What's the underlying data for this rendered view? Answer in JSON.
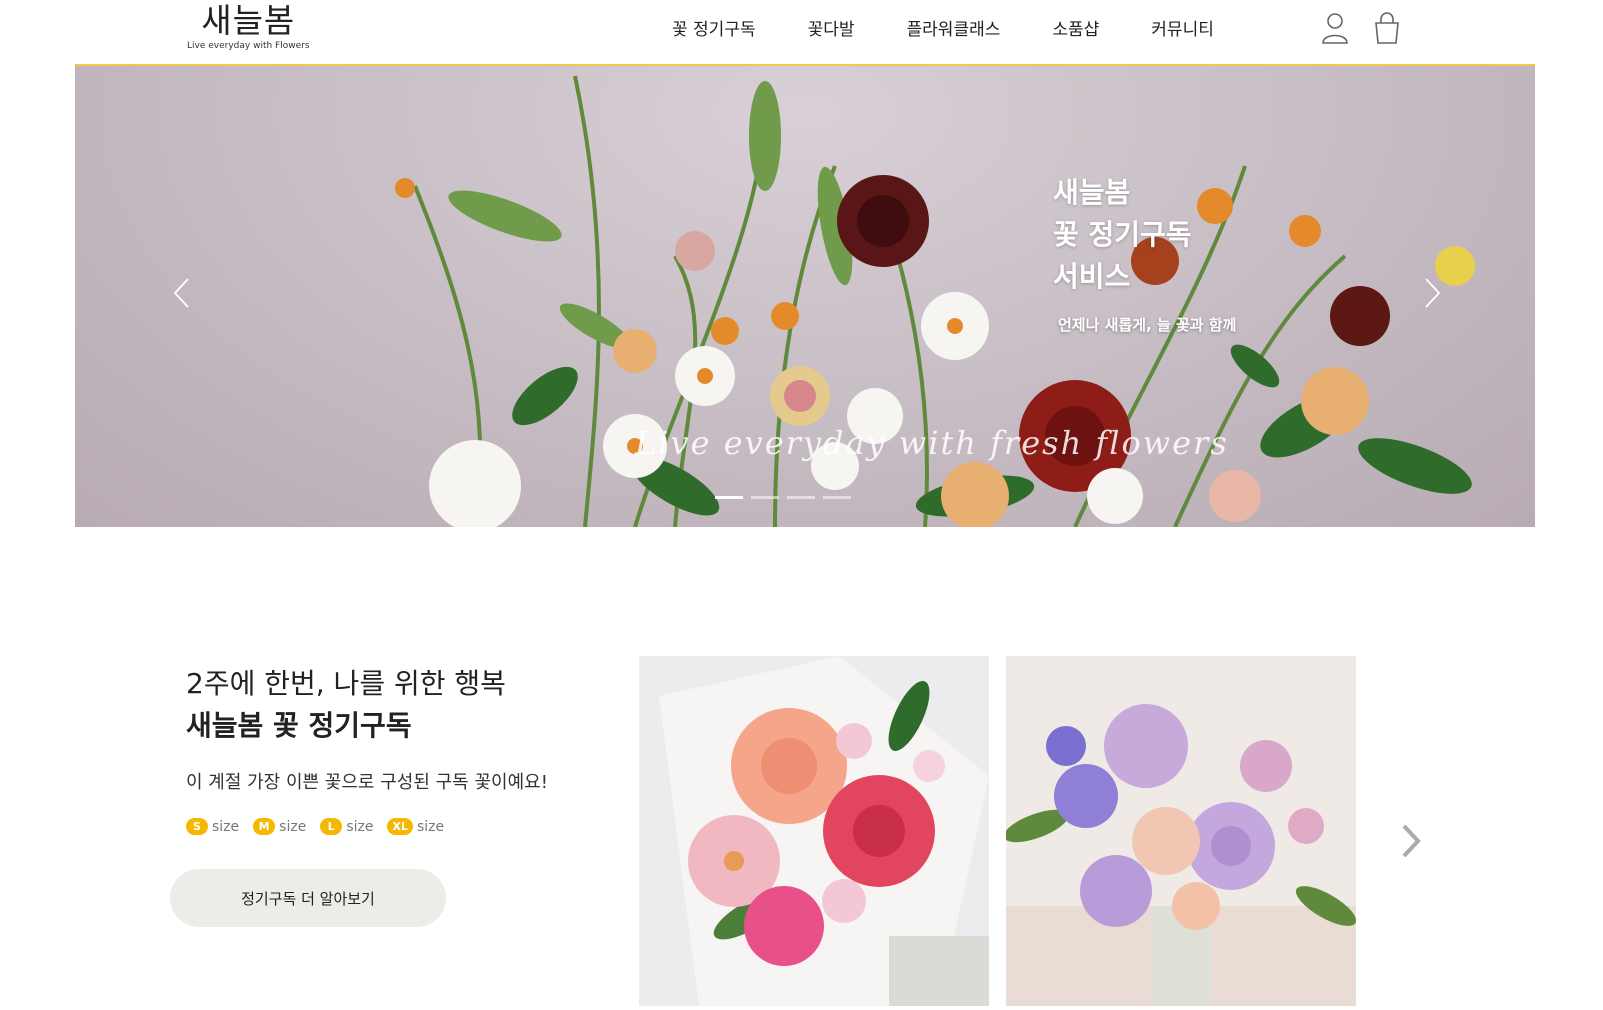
{
  "brand": {
    "name": "새늘봄",
    "tagline": "Live everyday with Flowers"
  },
  "nav": {
    "items": [
      {
        "label": "꽃 정기구독"
      },
      {
        "label": "꽃다발"
      },
      {
        "label": "플라워클래스"
      },
      {
        "label": "소품샵"
      },
      {
        "label": "커뮤니티"
      }
    ]
  },
  "header_icons": [
    "user-icon",
    "shopping-bag-icon"
  ],
  "hero": {
    "title_lines": [
      "새늘봄",
      "꽃 정기구독",
      "서비스"
    ],
    "subtitle": "언제나 새롭게, 늘 꽃과 함께",
    "script_text": "Live everyday with fresh flowers",
    "slide_count": 4,
    "active_slide": 1
  },
  "subscription": {
    "heading_line1": "2주에 한번, 나를 위한 행복",
    "heading_line2": "새늘봄 꽃 정기구독",
    "description": "이 계절 가장 이쁜 꽃으로 구성된 구독 꽃이예요!",
    "sizes": [
      {
        "badge": "S",
        "label": "size"
      },
      {
        "badge": "M",
        "label": "size"
      },
      {
        "badge": "L",
        "label": "size"
      },
      {
        "badge": "XL",
        "label": "size"
      }
    ],
    "button_label": "정기구독 더 알아보기"
  },
  "colors": {
    "accent": "#f5b800",
    "header_line": "#f2c94c",
    "button_bg": "#eeece8"
  }
}
